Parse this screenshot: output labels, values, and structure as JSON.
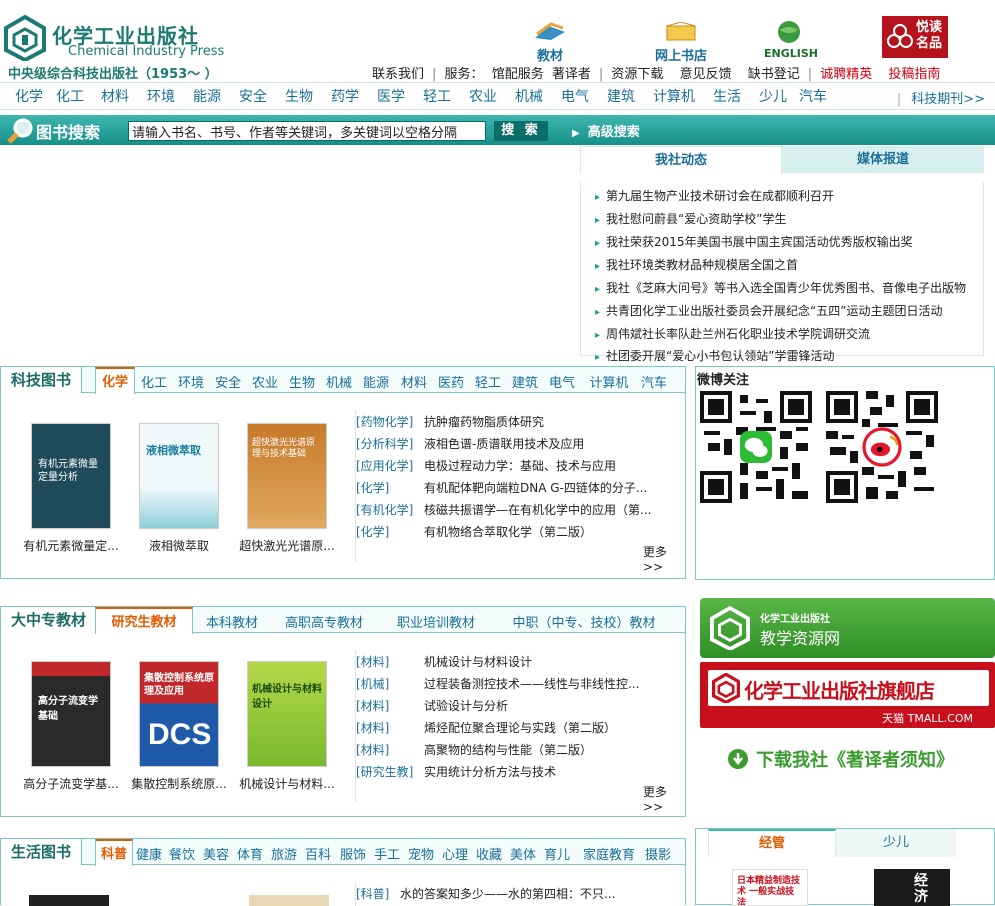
{
  "header": {
    "logo_cn": "化学工业出版社",
    "logo_en": "Chemical Industry Press",
    "tagline": "中央级综合科技出版社（1953～ ）",
    "icons": [
      {
        "label": "教材",
        "icon": "textbook-icon"
      },
      {
        "label": "网上书店",
        "icon": "online-bookstore-icon"
      },
      {
        "label": "ENGLISH",
        "icon": "globe-icon"
      },
      {
        "label": "悦读名品",
        "icon": "yuedu-logo-icon"
      }
    ],
    "top_links": [
      "联系我们",
      "服务：",
      "馆配服务",
      "著译者",
      "资源下载",
      "意见反馈",
      "缺书登记",
      "诚聘精英",
      "投稿指南"
    ]
  },
  "categories": [
    "化学",
    "化工",
    "材料",
    "环境",
    "能源",
    "安全",
    "生物",
    "药学",
    "医学",
    "轻工",
    "农业",
    "机械",
    "电气",
    "建筑",
    "计算机",
    "生活",
    "少儿",
    "汽车"
  ],
  "periodical_link": "科技期刊>>",
  "search": {
    "title": "图书搜索",
    "placeholder": "请输入书名、书号、作者等关键词，多关键词以空格分隔",
    "button": "搜 索",
    "advanced": "高级搜索"
  },
  "news": {
    "tabs": [
      "我社动态",
      "媒体报道"
    ],
    "items": [
      "第九届生物产业技术研讨会在成都顺利召开",
      "我社慰问蔚县“爱心资助学校”学生",
      "我社荣获2015年美国书展中国主宾国活动优秀版权输出奖",
      "我社环境类教材品种规模居全国之首",
      "我社《芝麻大问号》等书入选全国青少年优秀图书、音像电子出版物",
      "共青团化学工业出版社委员会开展纪念“五四”运动主题团日活动",
      "周伟斌社长率队赴兰州石化职业技术学院调研交流",
      "社团委开展“爱心小书包认领站”学雷锋活动"
    ]
  },
  "tech_books": {
    "title": "科技图书",
    "tabs": [
      "化学",
      "化工",
      "环境",
      "安全",
      "农业",
      "生物",
      "机械",
      "能源",
      "材料",
      "医药",
      "轻工",
      "建筑",
      "电气",
      "计算机",
      "汽车"
    ],
    "books": [
      {
        "title": "有机元素微量定...",
        "cover_text": "有机元素微量定量分析"
      },
      {
        "title": "液相微萃取",
        "cover_text": "液相微萃取"
      },
      {
        "title": "超快激光光谱原...",
        "cover_text": "超快激光光谱原理与技术基础"
      }
    ],
    "list": [
      {
        "tag": "[药物化学]",
        "name": "抗肿瘤药物脂质体研究"
      },
      {
        "tag": "[分析科学]",
        "name": "液相色谱-质谱联用技术及应用"
      },
      {
        "tag": "[应用化学]",
        "name": "电极过程动力学：基础、技术与应用"
      },
      {
        "tag": "[化学]",
        "name": "有机配体靶向端粒DNA G-四链体的分子..."
      },
      {
        "tag": "[有机化学]",
        "name": "核磁共振谱学—在有机化学中的应用（第..."
      },
      {
        "tag": "[化学]",
        "name": "有机物络合萃取化学（第二版）"
      }
    ],
    "more": "更多>>"
  },
  "textbooks": {
    "title": "大中专教材",
    "tabs": [
      "研究生教材",
      "本科教材",
      "高职高专教材",
      "职业培训教材",
      "中职（中专、技校）教材"
    ],
    "books": [
      {
        "title": "高分子流变学基...",
        "cover_text": "高分子流变学基础"
      },
      {
        "title": "集散控制系统原...",
        "cover_text": "集散控制系统原理及应用"
      },
      {
        "title": "机械设计与材料...",
        "cover_text": "机械设计与材料设计"
      }
    ],
    "list": [
      {
        "tag": "[材料]",
        "name": "机械设计与材料设计"
      },
      {
        "tag": "[机械]",
        "name": "过程装备测控技术——线性与非线性控..."
      },
      {
        "tag": "[材料]",
        "name": "试验设计与分析"
      },
      {
        "tag": "[材料]",
        "name": "烯烃配位聚合理论与实践（第二版）"
      },
      {
        "tag": "[材料]",
        "name": "高聚物的结构与性能（第二版）"
      },
      {
        "tag": "[研究生教]",
        "name": "实用统计分析方法与技术"
      }
    ],
    "more": "更多>>"
  },
  "life_books": {
    "title": "生活图书",
    "tabs": [
      "科普",
      "健康",
      "餐饮",
      "美容",
      "体育",
      "旅游",
      "百科",
      "服饰",
      "手工",
      "宠物",
      "心理",
      "收藏",
      "美体",
      "育儿",
      "家庭教育",
      "摄影"
    ],
    "list": [
      {
        "tag": "[科普]",
        "name": "水的答案知多少——水的第四相：不只..."
      }
    ]
  },
  "weibo": {
    "title": "微博关注"
  },
  "banners": {
    "teaching_brand": "化学工业出版社",
    "teaching_name": "教学资源网",
    "tmall_name": "化学工业出版社旗舰店",
    "tmall_brand": "天猫 TMALL.COM",
    "download": "下载我社《著译者须知》"
  },
  "right_tabs": [
    "经管",
    "少儿"
  ],
  "right_covers": [
    {
      "cover_text": "日本精益制造技术 一般实战技法"
    },
    {
      "cover_text": "经济"
    }
  ]
}
